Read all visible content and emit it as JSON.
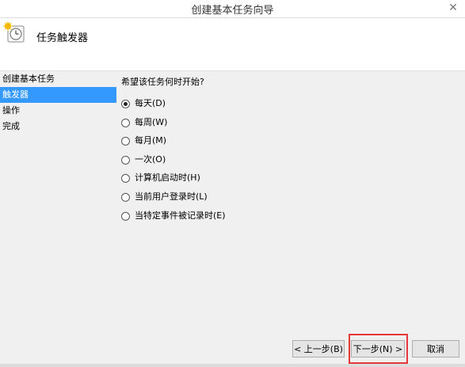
{
  "window": {
    "title": "创建基本任务向导",
    "close_label": "✕"
  },
  "header": {
    "heading": "任务触发器",
    "icon": "task-clock-icon"
  },
  "sidebar": {
    "items": [
      {
        "label": "创建基本任务",
        "active": false
      },
      {
        "label": "触发器",
        "active": true
      },
      {
        "label": "操作",
        "active": false
      },
      {
        "label": "完成",
        "active": false
      }
    ]
  },
  "main": {
    "question": "希望该任务何时开始?",
    "options": [
      {
        "label": "每天(D)",
        "checked": true
      },
      {
        "label": "每周(W)",
        "checked": false
      },
      {
        "label": "每月(M)",
        "checked": false
      },
      {
        "label": "一次(O)",
        "checked": false
      },
      {
        "label": "计算机启动时(H)",
        "checked": false
      },
      {
        "label": "当前用户登录时(L)",
        "checked": false
      },
      {
        "label": "当特定事件被记录时(E)",
        "checked": false
      }
    ]
  },
  "buttons": {
    "back": "< 上一步(B)",
    "next": "下一步(N) >",
    "cancel": "取消"
  },
  "colors": {
    "selection": "#3399ff",
    "highlight_box": "#e53939"
  }
}
